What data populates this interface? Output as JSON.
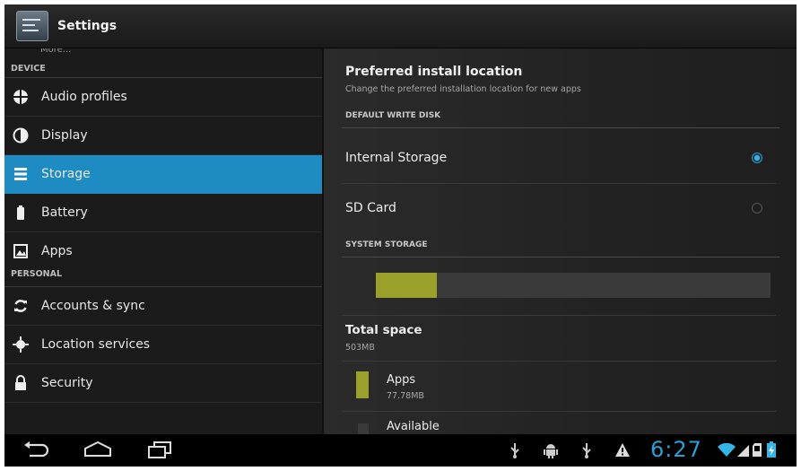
{
  "action_bar": {
    "title": "Settings",
    "app_icon": "settings-icon"
  },
  "sidebar": {
    "clipped_item": "More...",
    "sections": [
      {
        "header": "DEVICE",
        "items": [
          {
            "label": "Audio profiles",
            "icon": "audio-profiles-icon",
            "selected": false
          },
          {
            "label": "Display",
            "icon": "display-icon",
            "selected": false
          },
          {
            "label": "Storage",
            "icon": "storage-icon",
            "selected": true
          },
          {
            "label": "Battery",
            "icon": "battery-icon",
            "selected": false
          },
          {
            "label": "Apps",
            "icon": "apps-icon",
            "selected": false
          }
        ]
      },
      {
        "header": "PERSONAL",
        "items": [
          {
            "label": "Accounts & sync",
            "icon": "sync-icon",
            "selected": false
          },
          {
            "label": "Location services",
            "icon": "location-icon",
            "selected": false
          },
          {
            "label": "Security",
            "icon": "lock-icon",
            "selected": false
          }
        ]
      }
    ]
  },
  "detail": {
    "preferred_install": {
      "title": "Preferred install location",
      "subtitle": "Change the preferred installation location for new apps"
    },
    "default_write_disk": {
      "header": "DEFAULT WRITE DISK",
      "options": [
        {
          "label": "Internal Storage",
          "selected": true
        },
        {
          "label": "SD Card",
          "selected": false
        }
      ]
    },
    "system_storage": {
      "header": "SYSTEM STORAGE",
      "used_fraction": 0.155,
      "total_space": {
        "label": "Total space",
        "value": "503MB"
      },
      "apps": {
        "label": "Apps",
        "value": "77.78MB"
      },
      "available_label": "Available"
    }
  },
  "status_bar": {
    "time": "6:27",
    "notification_icons": [
      "usb-icon",
      "android-debug-icon",
      "usb-icon",
      "warning-icon"
    ],
    "system_icons": [
      "wifi-icon",
      "signal-icon",
      "sd-card-icon",
      "battery-status-icon"
    ]
  },
  "colors": {
    "accent": "#33b5e5",
    "selected_item": "#1e8bc3",
    "storage_used": "#99a12b",
    "clock": "#2f9fd2"
  }
}
